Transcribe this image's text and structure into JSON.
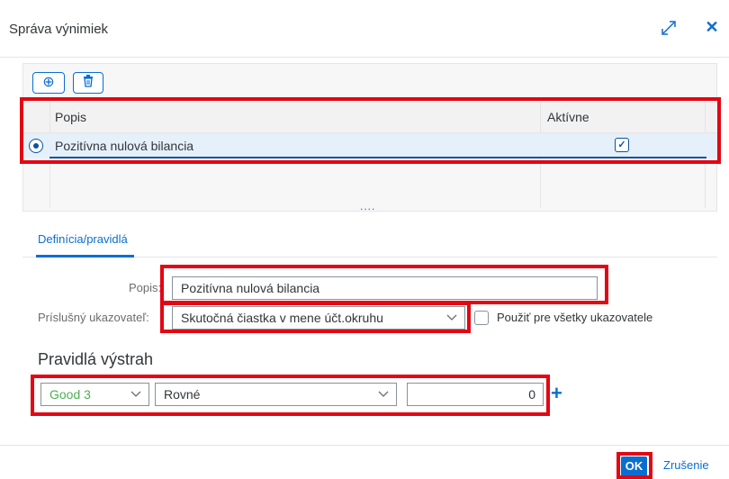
{
  "dialog": {
    "title": "Správa výnimiek",
    "expand_icon": "expand-icon",
    "close_icon": "close-icon",
    "close_glyph": "✕"
  },
  "toolbar": {
    "add_icon": "add-circle-icon",
    "add_glyph": "⊕",
    "delete_icon": "trash-icon"
  },
  "table": {
    "columns": [
      "Popis",
      "Aktívne"
    ],
    "rows": [
      {
        "popis": "Pozitívna nulová bilancia",
        "aktivne": "✓"
      }
    ],
    "more": "....",
    "selected_row": 0
  },
  "tabs": [
    {
      "label": "Definícia/pravidlá"
    }
  ],
  "form": {
    "popis_label": "Popis:",
    "popis_value": "Pozitívna nulová bilancia",
    "ukazovatel_label": "Príslušný ukazovateľ:",
    "ukazovatel_value": "Skutočná čiastka v mene účt.okruhu",
    "pouzit_label": "Použiť pre všetky ukazovatele",
    "pouzit_checked": false
  },
  "rules": {
    "title": "Pravidlá výstrah",
    "status_value": "Good 3",
    "status_color": "#4caf50",
    "operator_value": "Rovné",
    "number_value": "0",
    "add_glyph": "+"
  },
  "footer": {
    "ok_label": "OK",
    "cancel_label": "Zrušenie"
  },
  "colors": {
    "accent": "#0a6ed1",
    "highlight": "#e30613",
    "selected_row": "#e5f0fa"
  }
}
